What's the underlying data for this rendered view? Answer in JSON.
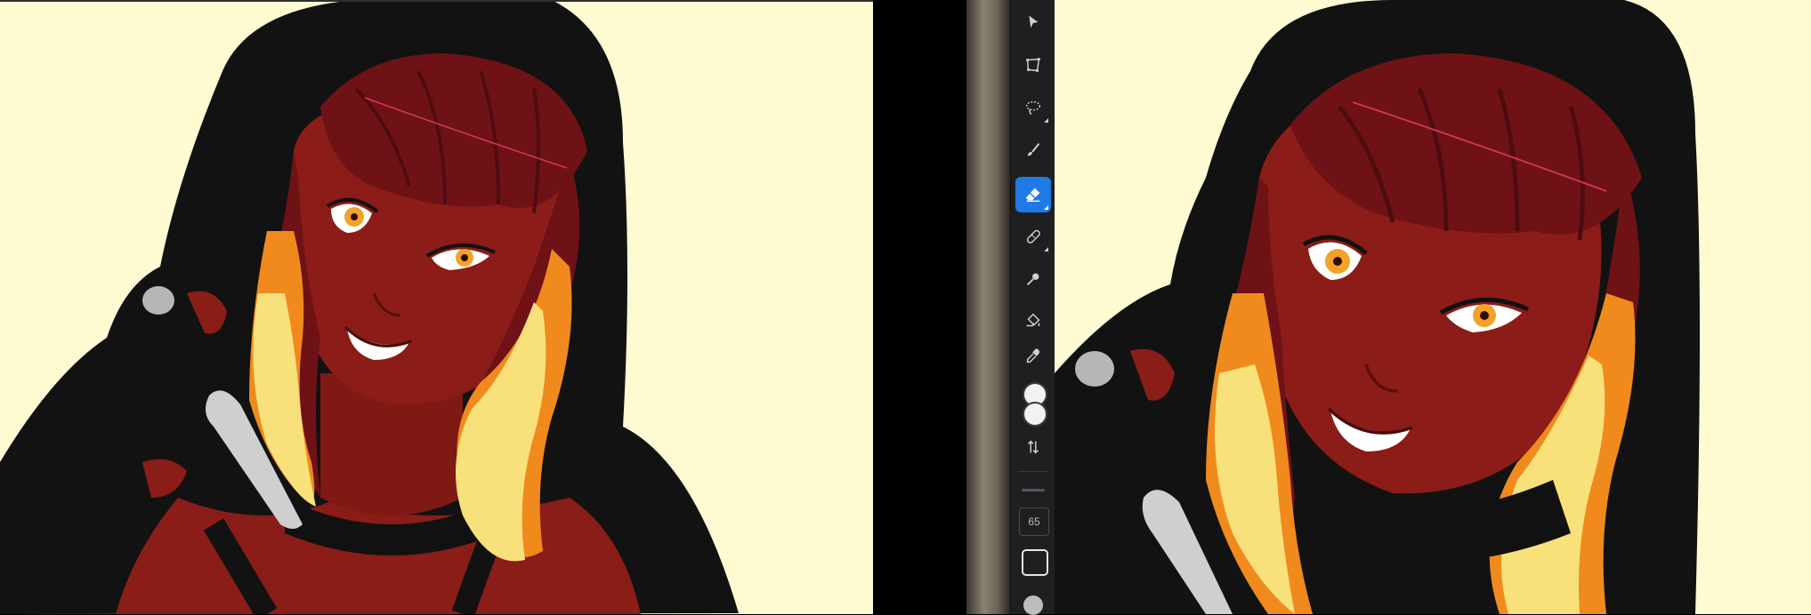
{
  "toolbar": {
    "tools": [
      {
        "name": "select-tool",
        "icon": "arrow-cursor-icon"
      },
      {
        "name": "transform-tool",
        "icon": "transform-icon"
      },
      {
        "name": "lasso-tool",
        "icon": "lasso-icon"
      },
      {
        "name": "brush-tool",
        "icon": "brush-icon"
      },
      {
        "name": "eraser-tool",
        "icon": "eraser-icon",
        "active": true
      },
      {
        "name": "smudge-tool",
        "icon": "bandage-icon"
      },
      {
        "name": "liquify-tool",
        "icon": "liquify-icon"
      },
      {
        "name": "fill-tool",
        "icon": "paint-bucket-icon"
      },
      {
        "name": "eyedropper-tool",
        "icon": "eyedropper-icon"
      }
    ],
    "brush_size": "65",
    "accent_color": "#1f7ae6"
  },
  "colors": {
    "canvas_background": "#fefbd3",
    "hood": "#111111",
    "skin": "#8c1c17",
    "hair": "#6e1216",
    "flame_yellow": "#f8e07a",
    "flame_orange": "#f08a1c"
  }
}
